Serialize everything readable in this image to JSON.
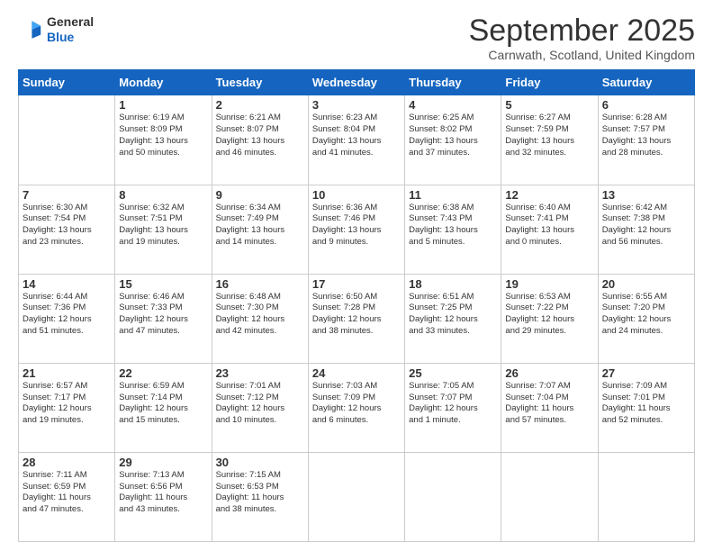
{
  "logo": {
    "general": "General",
    "blue": "Blue"
  },
  "header": {
    "month": "September 2025",
    "location": "Carnwath, Scotland, United Kingdom"
  },
  "days_of_week": [
    "Sunday",
    "Monday",
    "Tuesday",
    "Wednesday",
    "Thursday",
    "Friday",
    "Saturday"
  ],
  "weeks": [
    [
      {
        "day": "",
        "info": ""
      },
      {
        "day": "1",
        "info": "Sunrise: 6:19 AM\nSunset: 8:09 PM\nDaylight: 13 hours\nand 50 minutes."
      },
      {
        "day": "2",
        "info": "Sunrise: 6:21 AM\nSunset: 8:07 PM\nDaylight: 13 hours\nand 46 minutes."
      },
      {
        "day": "3",
        "info": "Sunrise: 6:23 AM\nSunset: 8:04 PM\nDaylight: 13 hours\nand 41 minutes."
      },
      {
        "day": "4",
        "info": "Sunrise: 6:25 AM\nSunset: 8:02 PM\nDaylight: 13 hours\nand 37 minutes."
      },
      {
        "day": "5",
        "info": "Sunrise: 6:27 AM\nSunset: 7:59 PM\nDaylight: 13 hours\nand 32 minutes."
      },
      {
        "day": "6",
        "info": "Sunrise: 6:28 AM\nSunset: 7:57 PM\nDaylight: 13 hours\nand 28 minutes."
      }
    ],
    [
      {
        "day": "7",
        "info": "Sunrise: 6:30 AM\nSunset: 7:54 PM\nDaylight: 13 hours\nand 23 minutes."
      },
      {
        "day": "8",
        "info": "Sunrise: 6:32 AM\nSunset: 7:51 PM\nDaylight: 13 hours\nand 19 minutes."
      },
      {
        "day": "9",
        "info": "Sunrise: 6:34 AM\nSunset: 7:49 PM\nDaylight: 13 hours\nand 14 minutes."
      },
      {
        "day": "10",
        "info": "Sunrise: 6:36 AM\nSunset: 7:46 PM\nDaylight: 13 hours\nand 9 minutes."
      },
      {
        "day": "11",
        "info": "Sunrise: 6:38 AM\nSunset: 7:43 PM\nDaylight: 13 hours\nand 5 minutes."
      },
      {
        "day": "12",
        "info": "Sunrise: 6:40 AM\nSunset: 7:41 PM\nDaylight: 13 hours\nand 0 minutes."
      },
      {
        "day": "13",
        "info": "Sunrise: 6:42 AM\nSunset: 7:38 PM\nDaylight: 12 hours\nand 56 minutes."
      }
    ],
    [
      {
        "day": "14",
        "info": "Sunrise: 6:44 AM\nSunset: 7:36 PM\nDaylight: 12 hours\nand 51 minutes."
      },
      {
        "day": "15",
        "info": "Sunrise: 6:46 AM\nSunset: 7:33 PM\nDaylight: 12 hours\nand 47 minutes."
      },
      {
        "day": "16",
        "info": "Sunrise: 6:48 AM\nSunset: 7:30 PM\nDaylight: 12 hours\nand 42 minutes."
      },
      {
        "day": "17",
        "info": "Sunrise: 6:50 AM\nSunset: 7:28 PM\nDaylight: 12 hours\nand 38 minutes."
      },
      {
        "day": "18",
        "info": "Sunrise: 6:51 AM\nSunset: 7:25 PM\nDaylight: 12 hours\nand 33 minutes."
      },
      {
        "day": "19",
        "info": "Sunrise: 6:53 AM\nSunset: 7:22 PM\nDaylight: 12 hours\nand 29 minutes."
      },
      {
        "day": "20",
        "info": "Sunrise: 6:55 AM\nSunset: 7:20 PM\nDaylight: 12 hours\nand 24 minutes."
      }
    ],
    [
      {
        "day": "21",
        "info": "Sunrise: 6:57 AM\nSunset: 7:17 PM\nDaylight: 12 hours\nand 19 minutes."
      },
      {
        "day": "22",
        "info": "Sunrise: 6:59 AM\nSunset: 7:14 PM\nDaylight: 12 hours\nand 15 minutes."
      },
      {
        "day": "23",
        "info": "Sunrise: 7:01 AM\nSunset: 7:12 PM\nDaylight: 12 hours\nand 10 minutes."
      },
      {
        "day": "24",
        "info": "Sunrise: 7:03 AM\nSunset: 7:09 PM\nDaylight: 12 hours\nand 6 minutes."
      },
      {
        "day": "25",
        "info": "Sunrise: 7:05 AM\nSunset: 7:07 PM\nDaylight: 12 hours\nand 1 minute."
      },
      {
        "day": "26",
        "info": "Sunrise: 7:07 AM\nSunset: 7:04 PM\nDaylight: 11 hours\nand 57 minutes."
      },
      {
        "day": "27",
        "info": "Sunrise: 7:09 AM\nSunset: 7:01 PM\nDaylight: 11 hours\nand 52 minutes."
      }
    ],
    [
      {
        "day": "28",
        "info": "Sunrise: 7:11 AM\nSunset: 6:59 PM\nDaylight: 11 hours\nand 47 minutes."
      },
      {
        "day": "29",
        "info": "Sunrise: 7:13 AM\nSunset: 6:56 PM\nDaylight: 11 hours\nand 43 minutes."
      },
      {
        "day": "30",
        "info": "Sunrise: 7:15 AM\nSunset: 6:53 PM\nDaylight: 11 hours\nand 38 minutes."
      },
      {
        "day": "",
        "info": ""
      },
      {
        "day": "",
        "info": ""
      },
      {
        "day": "",
        "info": ""
      },
      {
        "day": "",
        "info": ""
      }
    ]
  ]
}
